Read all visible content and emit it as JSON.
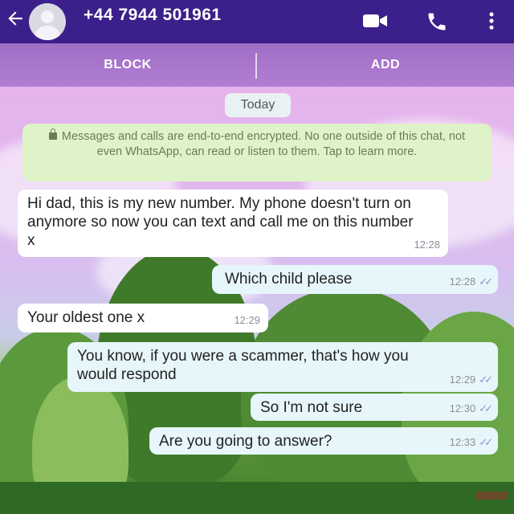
{
  "header": {
    "phone": "+44 7944 501961",
    "icons": [
      "back-arrow-icon",
      "avatar",
      "video-call-icon",
      "voice-call-icon",
      "more-vert-icon"
    ]
  },
  "actions": {
    "block_label": "BLOCK",
    "add_label": "ADD"
  },
  "chat": {
    "date_chip": "Today",
    "encryption_notice": "Messages and calls are end-to-end encrypted. No one outside of this chat, not even WhatsApp, can read or listen to them. Tap to learn more.",
    "messages": [
      {
        "direction": "in",
        "text": "Hi dad, this is my new number. My phone doesn't turn on anymore so now you can text and call me on this number x",
        "time": "12:28"
      },
      {
        "direction": "out",
        "text": "Which child please",
        "time": "12:28",
        "status": "read"
      },
      {
        "direction": "in",
        "text": "Your oldest one x",
        "time": "12:29"
      },
      {
        "direction": "out",
        "text": "You know, if you were a scammer, that's how you would respond",
        "time": "12:29",
        "status": "read"
      },
      {
        "direction": "out",
        "text": "So I'm not sure",
        "time": "12:30",
        "status": "read"
      },
      {
        "direction": "out",
        "text": "Are you going to answer?",
        "time": "12:33",
        "status": "read"
      }
    ]
  },
  "colors": {
    "header_bg": "#3b1f8a",
    "actionbar_bg": "#a06ec6",
    "incoming_bubble": "#ffffff",
    "outgoing_bubble": "#e7f6fb",
    "notice_bg": "#dff3c8",
    "read_ticks": "#8a93c8"
  }
}
